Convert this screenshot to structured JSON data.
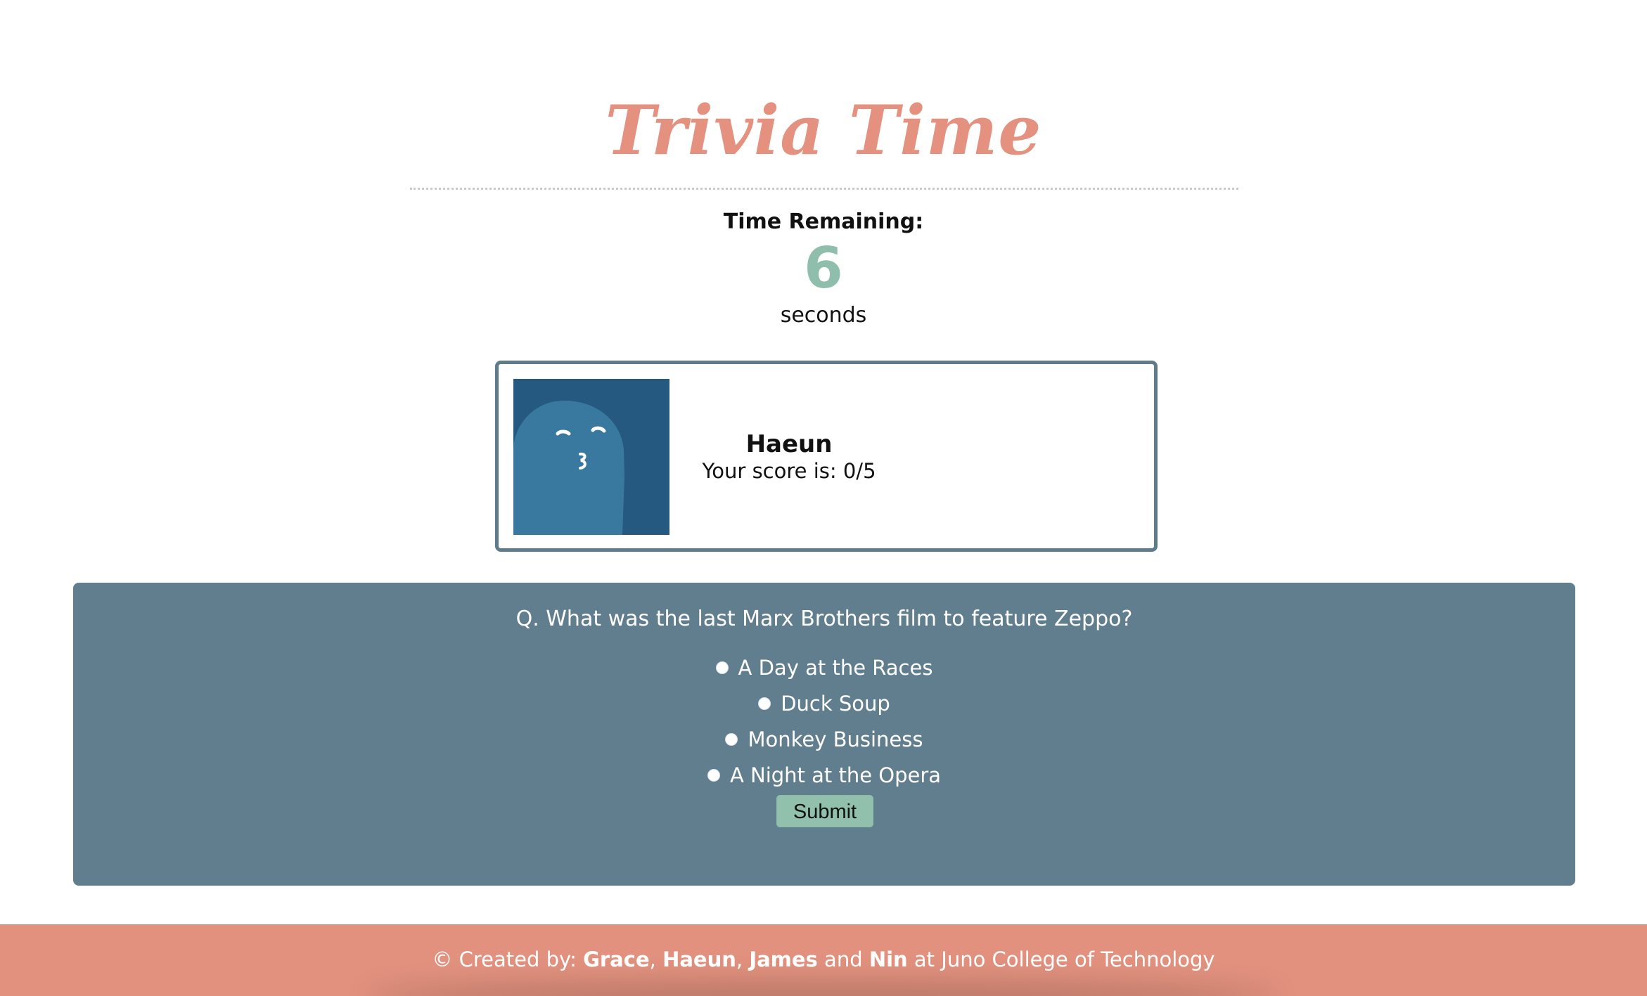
{
  "app": {
    "title": "Trivia Time"
  },
  "timer": {
    "label": "Time Remaining:",
    "value": "6",
    "unit": "seconds"
  },
  "player": {
    "name": "Haeun",
    "score_text": "Your score is: 0/5"
  },
  "question": {
    "text": "Q. What was the last Marx Brothers film to feature Zeppo?",
    "answers": [
      "A Day at the Races",
      "Duck Soup",
      "Monkey Business",
      "A Night at the Opera"
    ],
    "submit_label": "Submit"
  },
  "footer": {
    "prefix": "© Created by: ",
    "names": [
      "Grace",
      "Haeun",
      "James",
      "Nin"
    ],
    "separator_1": ", ",
    "separator_2": ", ",
    "connector": " and ",
    "suffix": " at Juno College of Technology"
  },
  "colors": {
    "title": "#e5917f",
    "timer_number": "#8fbfac",
    "card_border": "#5f7c8c",
    "avatar_background": "#25597f",
    "avatar_figure": "#3979a0",
    "question_panel": "#617e8f",
    "submit_button": "#91c0ad",
    "footer": "#e2917e"
  },
  "icons": {
    "avatar": "ghost-avatar-icon",
    "answer_selector": "radio-icon"
  }
}
